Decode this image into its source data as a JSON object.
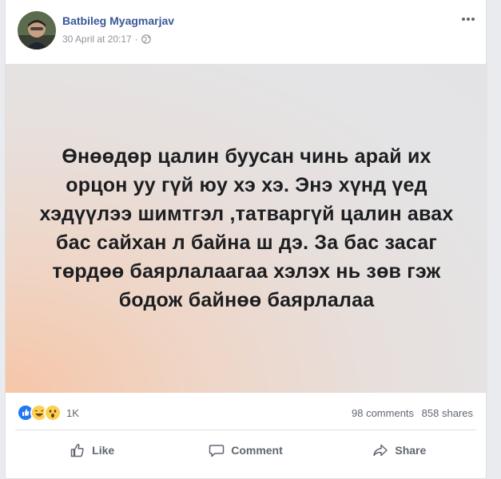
{
  "post": {
    "author": "Batbileg Myagmarjav",
    "timestamp": "30 April at 20:17",
    "separator": "·",
    "privacy_icon": "globe-icon",
    "more_icon": "more-horizontal-icon",
    "text": "Өнөөдөр цалин буусан чинь арай их орцон уу гүй юу хэ хэ. Энэ хүнд үед хэдүүлээ шимтгэл ,татваргүй цалин авах бас сайхан л байна ш дэ. За бас засаг төрдөө баярлалаагаа хэлэх нь зөв гэж бодож байнөө баярлалаа"
  },
  "stats": {
    "reaction_icons": [
      "like-reaction-icon",
      "haha-reaction-icon",
      "wow-reaction-icon"
    ],
    "reaction_count": "1K",
    "comments": "98 comments",
    "shares": "858 shares"
  },
  "actions": {
    "like": "Like",
    "comment": "Comment",
    "share": "Share"
  },
  "colors": {
    "author": "#385898",
    "meta": "#90949c",
    "like_blue": "#2078f4",
    "reaction_yellow": "#fcd150"
  }
}
